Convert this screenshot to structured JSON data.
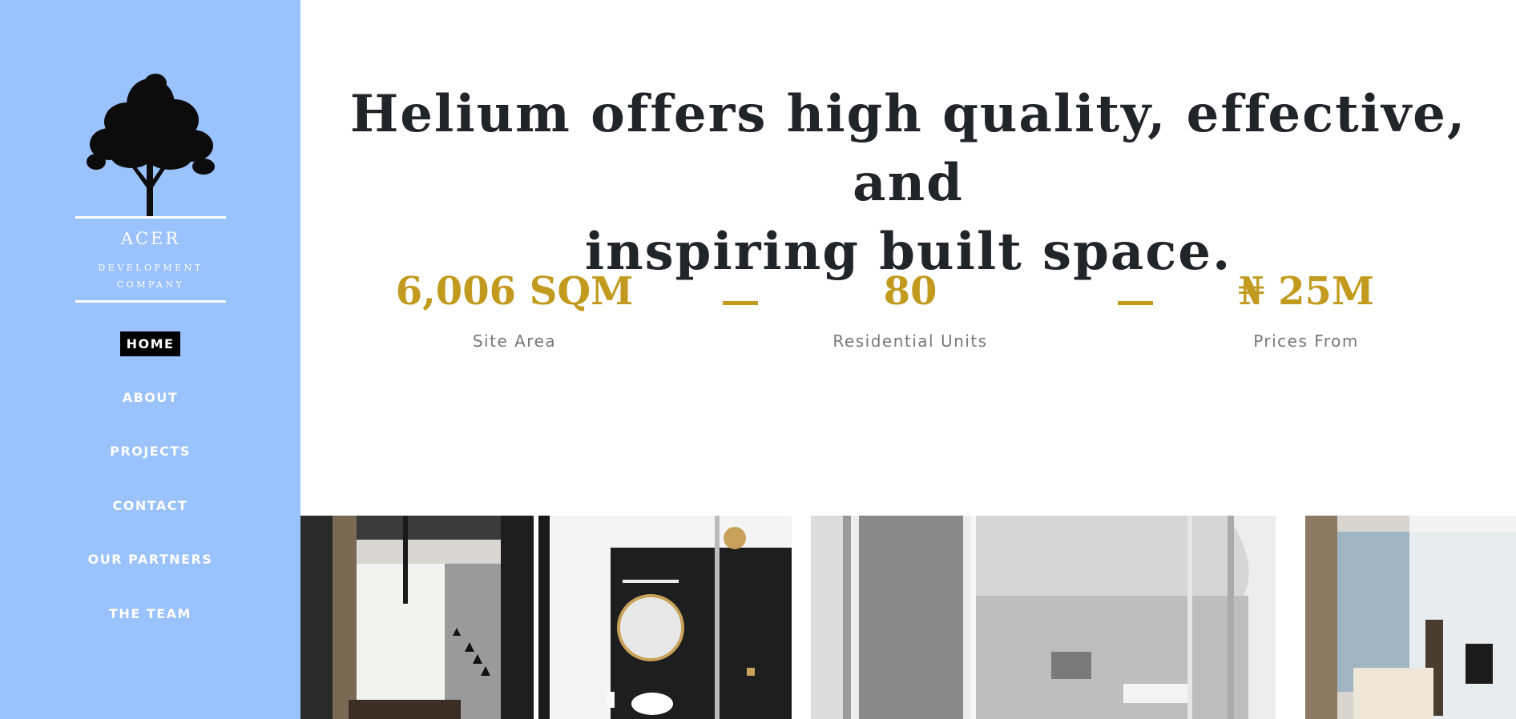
{
  "brand": {
    "name": "ACER",
    "subtitle_line1": "DEVELOPMENT",
    "subtitle_line2": "COMPANY",
    "logo_icon": "tree-icon"
  },
  "nav": {
    "items": [
      {
        "label": "HOME",
        "active": true
      },
      {
        "label": "ABOUT"
      },
      {
        "label": "PROJECTS"
      },
      {
        "label": "CONTACT"
      },
      {
        "label": "OUR PARTNERS"
      },
      {
        "label": "THE TEAM"
      }
    ]
  },
  "hero": {
    "headline_line1": "Helium offers high quality, effective, and",
    "headline_line2": "inspiring built space."
  },
  "stats": [
    {
      "value": "6,006 SQM",
      "label": "Site Area"
    },
    {
      "value": "80",
      "label": "Residential Units"
    },
    {
      "value": "₦ 25M",
      "label": "Prices From"
    }
  ],
  "gallery": {
    "images": [
      "interior-living-room",
      "bathroom-round-mirror",
      "building-atrium-render",
      "bedroom-suite"
    ]
  },
  "colors": {
    "sidebar": "#9ac2fd",
    "accent": "#c19a1e",
    "headline": "#212529",
    "label": "#777777"
  }
}
